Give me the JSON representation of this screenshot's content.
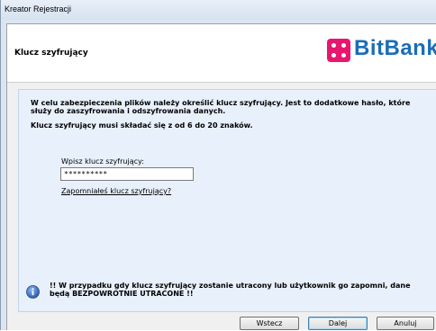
{
  "window": {
    "title": "Kreator Rejestracji"
  },
  "header": {
    "title": "Klucz szyfrujący",
    "logo_text": "BitBank",
    "logo_color": "#e8166f",
    "logo_text_color": "#1a6db8"
  },
  "content": {
    "intro": "W celu zabezpieczenia plików należy określić klucz szyfrujący. Jest to dodatkowe hasło, które służy do zaszyfrowania i odszyfrowania danych.",
    "rule": "Klucz szyfrujący musi składać się z od 6 do 20 znaków.",
    "field_label": "Wpisz klucz szyfrujący:",
    "field_value": "**********",
    "forgot_link": "Zapomniałeś klucz szyfrujący?",
    "warning": "!! W przypadku gdy klucz szyfrujący zostanie utracony lub użytkownik go zapomni, dane będą BEZPOWROTNIE UTRACONE !!",
    "info_icon": "info-icon"
  },
  "buttons": {
    "back": "Wstecz",
    "next": "Dalej",
    "cancel": "Anuluj"
  }
}
